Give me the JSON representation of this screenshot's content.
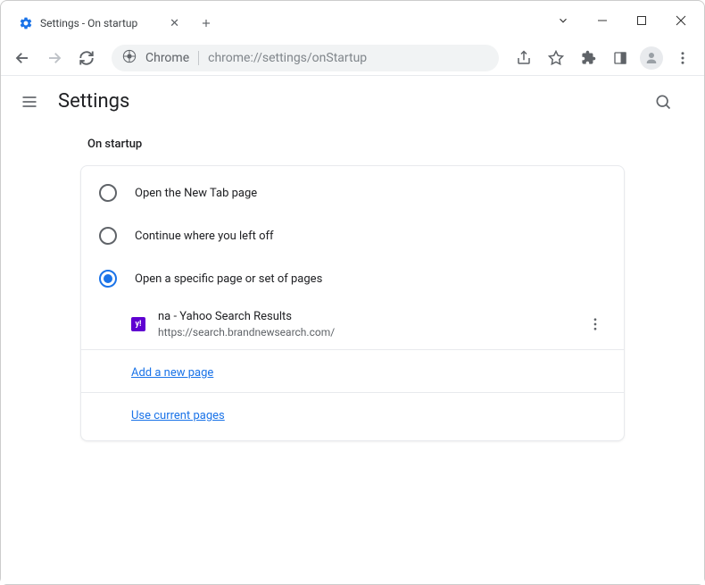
{
  "window": {
    "tab_title": "Settings - On startup"
  },
  "toolbar": {
    "chrome_label": "Chrome",
    "url": "chrome://settings/onStartup"
  },
  "header": {
    "title": "Settings"
  },
  "section": {
    "title": "On startup",
    "options": [
      {
        "label": "Open the New Tab page",
        "selected": false
      },
      {
        "label": "Continue where you left off",
        "selected": false
      },
      {
        "label": "Open a specific page or set of pages",
        "selected": true
      }
    ],
    "pages": [
      {
        "favicon_letter": "y!",
        "title": "na - Yahoo Search Results",
        "url": "https://search.brandnewsearch.com/"
      }
    ],
    "add_page_label": "Add a new page",
    "use_current_label": "Use current pages"
  }
}
